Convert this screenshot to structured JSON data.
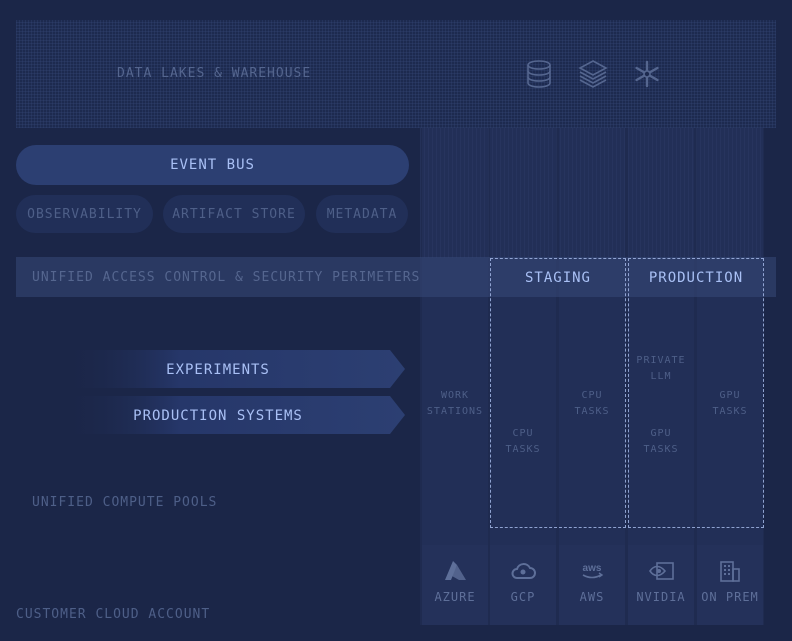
{
  "data_lakes": {
    "label": "DATA LAKES & WAREHOUSE",
    "icons": [
      "database-icon",
      "layers-icon",
      "snowflake-icon"
    ]
  },
  "event_bus": {
    "label": "EVENT BUS"
  },
  "services": [
    "OBSERVABILITY",
    "ARTIFACT STORE",
    "METADATA"
  ],
  "access": {
    "label": "UNIFIED ACCESS CONTROL & SECURITY PERIMETERS"
  },
  "zones": {
    "staging": "STAGING",
    "production": "PRODUCTION"
  },
  "workloads": {
    "experiments": "EXPERIMENTS",
    "production_systems": "PRODUCTION SYSTEMS"
  },
  "compute": {
    "label": "UNIFIED COMPUTE POOLS"
  },
  "customer": {
    "label": "CUSTOMER CLOUD ACCOUNT"
  },
  "tasks": {
    "workstations": [
      "WORK",
      "STATIONS"
    ],
    "cpu_staging": [
      "CPU",
      "TASKS"
    ],
    "cpu_aws": [
      "CPU",
      "TASKS"
    ],
    "private_llm": [
      "PRIVATE",
      "LLM"
    ],
    "gpu_nvidia": [
      "GPU",
      "TASKS"
    ],
    "gpu_prem": [
      "GPU",
      "TASKS"
    ]
  },
  "providers": [
    {
      "label": "AZURE",
      "icon": "azure-icon"
    },
    {
      "label": "GCP",
      "icon": "gcp-icon"
    },
    {
      "label": "AWS",
      "icon": "aws-icon"
    },
    {
      "label": "NVIDIA",
      "icon": "nvidia-icon"
    },
    {
      "label": "ON PREM",
      "icon": "building-icon"
    }
  ],
  "colors": {
    "background": "#1b2648",
    "accent_text": "#a9c0f5",
    "muted_text": "#4e5f88",
    "event_bus": "#2c3f72"
  }
}
